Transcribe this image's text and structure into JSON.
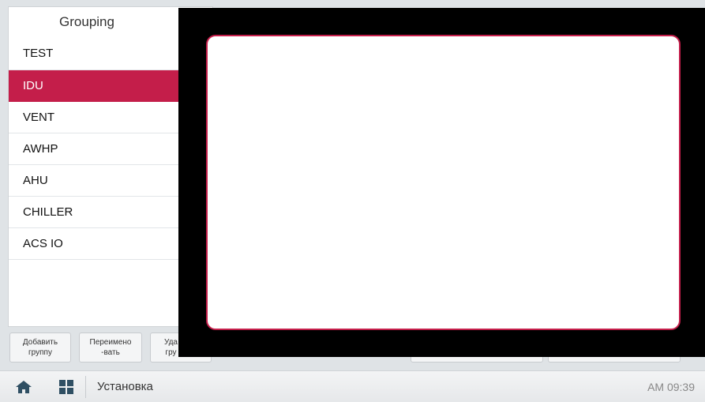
{
  "panel": {
    "title": "Grouping",
    "groups": [
      "TEST",
      "IDU",
      "VENT",
      "AWHP",
      "AHU",
      "CHILLER",
      "ACS IO"
    ],
    "selected": "IDU"
  },
  "actions": {
    "add_label": "Добавить\nгруппу",
    "rename_label": "Переимено\n-вать",
    "delete_label_partial": "Уда\nгру"
  },
  "status_bar": {
    "title": "Установка",
    "time": "AM 09:39",
    "home_icon": "home-icon",
    "apps_icon": "grid-icon"
  },
  "colors": {
    "accent": "#c41e4a",
    "overlay": "#000000"
  }
}
